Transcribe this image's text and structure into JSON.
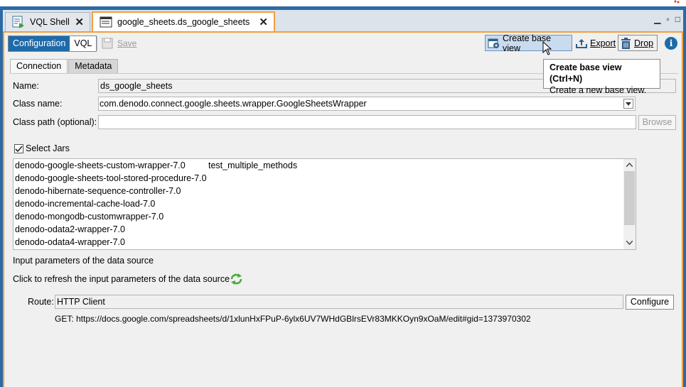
{
  "tabs": [
    {
      "label": "VQL Shell",
      "icon": "vql-shell-icon"
    },
    {
      "label": "google_sheets.ds_google_sheets",
      "icon": "datasource-icon"
    }
  ],
  "toolbar": {
    "config_label": "Configuration",
    "vql_label": "VQL",
    "save_label": "Save",
    "create_base_view_label": "Create base view",
    "export_label": "Export",
    "drop_label": "Drop",
    "info_label": "i"
  },
  "tooltip": {
    "title": "Create base view  (Ctrl+N)",
    "text": "Create a new base view."
  },
  "subtabs": [
    "Connection",
    "Metadata"
  ],
  "form": {
    "name_label": "Name:",
    "name_value": "ds_google_sheets",
    "classname_label": "Class name:",
    "classname_value": "com.denodo.connect.google.sheets.wrapper.GoogleSheetsWrapper",
    "classpath_label": "Class path (optional):",
    "classpath_value": "",
    "browse_label": "Browse",
    "select_jars_label": "Select Jars"
  },
  "jars": [
    "denodo-google-sheets-custom-wrapper-7.0",
    "denodo-google-sheets-tool-stored-procedure-7.0",
    "denodo-hibernate-sequence-controller-7.0",
    "denodo-incremental-cache-load-7.0",
    "denodo-mongodb-customwrapper-7.0",
    "denodo-odata2-wrapper-7.0",
    "denodo-odata4-wrapper-7.0"
  ],
  "jars_second_column": "test_multiple_methods",
  "input_params": {
    "heading": "Input parameters of the data source",
    "refresh_text": "Click to refresh the input parameters of the data source",
    "route_label": "Route:",
    "route_value": "HTTP Client",
    "configure_label": "Configure",
    "get_url": "GET: https://docs.google.com/spreadsheets/d/1xlunHxFPuP-6ylx6UV7WHdGBlrsEVr83MKKOyn9xOaM/edit#gid=1373970302"
  },
  "colors": {
    "accent": "#f0a03c",
    "selected": "#1f6aa8",
    "background": "#2b6aa5"
  }
}
